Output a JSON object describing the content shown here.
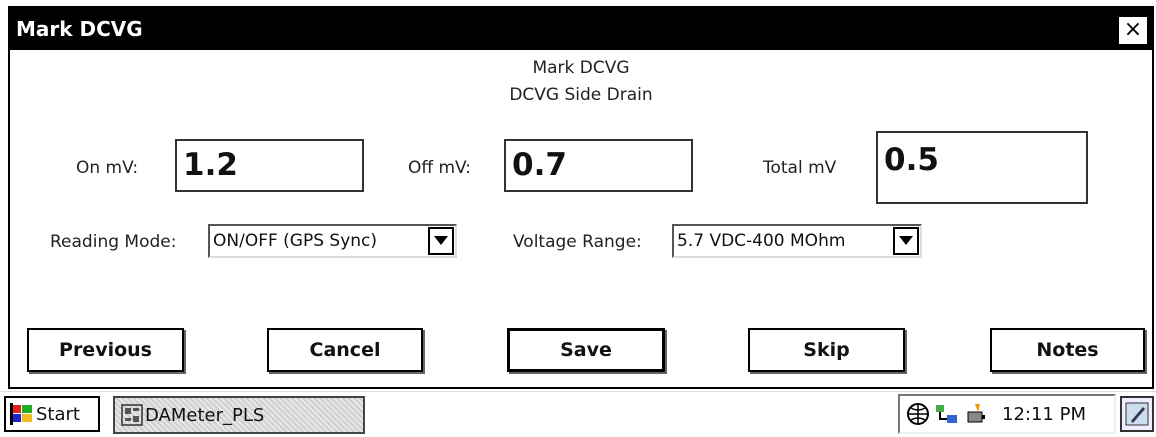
{
  "window": {
    "title": "Mark DCVG",
    "close_glyph": "×"
  },
  "header": {
    "line1": "Mark DCVG",
    "line2": "DCVG Side Drain"
  },
  "readings": {
    "on_label": "On mV:",
    "on_value": "1.2",
    "off_label": "Off mV:",
    "off_value": "0.7",
    "total_label": "Total mV",
    "total_value": "0.5"
  },
  "options": {
    "reading_mode_label": "Reading Mode:",
    "reading_mode_value": "ON/OFF (GPS Sync)",
    "voltage_range_label": "Voltage Range:",
    "voltage_range_value": "5.7 VDC-400 MOhm"
  },
  "buttons": {
    "previous": "Previous",
    "cancel": "Cancel",
    "save": "Save",
    "skip": "Skip",
    "notes": "Notes"
  },
  "taskbar": {
    "start_label": "Start",
    "task_label": "DAMeter_PLS",
    "clock": "12:11 PM",
    "icons": [
      "start-flag-icon",
      "app-icon",
      "network-icon",
      "connection-icon",
      "power-icon",
      "pen-icon"
    ]
  }
}
